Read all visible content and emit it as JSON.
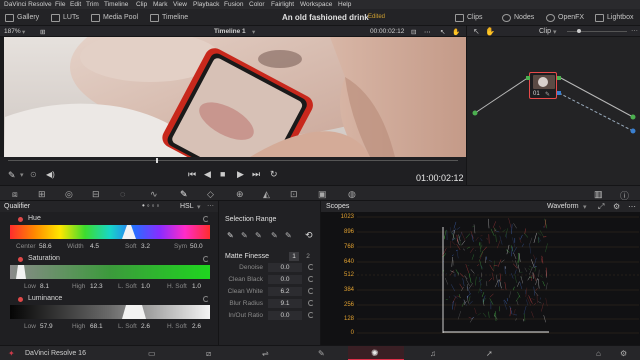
{
  "menu": [
    "DaVinci Resolve",
    "File",
    "Edit",
    "Trim",
    "Timeline",
    "Clip",
    "Mark",
    "View",
    "Playback",
    "Fusion",
    "Color",
    "Fairlight",
    "Workspace",
    "Help"
  ],
  "toolbar": {
    "gallery": "Gallery",
    "luts": "LUTs",
    "media_pool": "Media Pool",
    "timeline": "Timeline",
    "project_title": "An old fashioned drink",
    "edited": "Edited",
    "clips": "Clips",
    "nodes": "Nodes",
    "openfx": "OpenFX",
    "lightbox": "Lightbox"
  },
  "viewer": {
    "zoom": "187%",
    "timeline_name": "Timeline 1",
    "header_timecode": "00:00:02:12",
    "timecode": "01:00:02:12",
    "mode": "Clip"
  },
  "node": {
    "label": "01"
  },
  "qualifier": {
    "title": "Qualifier",
    "mode": "HSL",
    "hue": {
      "label": "Hue",
      "center_label": "Center",
      "center": "58.6",
      "width_label": "Width",
      "width": "4.5",
      "soft_label": "Soft",
      "soft": "3.2",
      "sym_label": "Sym",
      "sym": "50.0"
    },
    "saturation": {
      "label": "Saturation",
      "low_label": "Low",
      "low": "8.1",
      "high_label": "High",
      "high": "12.3",
      "lsoft_label": "L. Soft",
      "lsoft": "1.0",
      "hsoft_label": "H. Soft",
      "hsoft": "1.0"
    },
    "luminance": {
      "label": "Luminance",
      "low_label": "Low",
      "low": "57.9",
      "high_label": "High",
      "high": "68.1",
      "lsoft_label": "L. Soft",
      "lsoft": "2.6",
      "hsoft_label": "H. Soft",
      "hsoft": "2.6"
    }
  },
  "selection": {
    "title": "Selection Range",
    "matte_title": "Matte Finesse",
    "page1": "1",
    "page2": "2",
    "rows": [
      {
        "label": "Denoise",
        "value": "0.0"
      },
      {
        "label": "Clean Black",
        "value": "0.0"
      },
      {
        "label": "Clean White",
        "value": "6.2"
      },
      {
        "label": "Blur Radius",
        "value": "9.1"
      },
      {
        "label": "In/Out Ratio",
        "value": "0.0"
      }
    ]
  },
  "scopes": {
    "title": "Scopes",
    "type": "Waveform",
    "scale": [
      "1023",
      "896",
      "768",
      "640",
      "512",
      "384",
      "256",
      "128",
      "0"
    ]
  },
  "bottom": {
    "app_name": "DaVinci Resolve 16"
  },
  "colors": {
    "accent": "#e0304a",
    "scale": "#e0a030",
    "background": "#1e1e20"
  }
}
